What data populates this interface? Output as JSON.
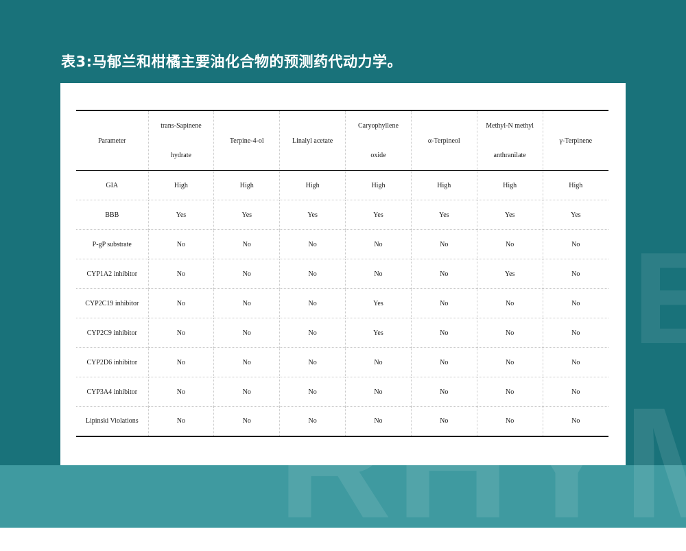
{
  "title": "表3:马郁兰和柑橘主要油化合物的预测药代动力学。",
  "watermark": {
    "right": "E",
    "bottom": "RHYME"
  },
  "table": {
    "headers": [
      {
        "line1": "Parameter",
        "line2": ""
      },
      {
        "line1": "trans-Sapinene",
        "line2": "hydrate"
      },
      {
        "line1": "Terpine-4-ol",
        "line2": ""
      },
      {
        "line1": "Linalyl acetate",
        "line2": ""
      },
      {
        "line1": "Caryophyllene",
        "line2": "oxide"
      },
      {
        "line1": "α-Terpineol",
        "line2": ""
      },
      {
        "line1": "Methyl-N methyl",
        "line2": "anthranilate"
      },
      {
        "line1": "γ-Terpinene",
        "line2": ""
      }
    ],
    "rows": [
      [
        "GIA",
        "High",
        "High",
        "High",
        "High",
        "High",
        "High",
        "High"
      ],
      [
        "BBB",
        "Yes",
        "Yes",
        "Yes",
        "Yes",
        "Yes",
        "Yes",
        "Yes"
      ],
      [
        "P-gP substrate",
        "No",
        "No",
        "No",
        "No",
        "No",
        "No",
        "No"
      ],
      [
        "CYP1A2 inhibitor",
        "No",
        "No",
        "No",
        "No",
        "No",
        "Yes",
        "No"
      ],
      [
        "CYP2C19 inhibitor",
        "No",
        "No",
        "No",
        "Yes",
        "No",
        "No",
        "No"
      ],
      [
        "CYP2C9 inhibitor",
        "No",
        "No",
        "No",
        "Yes",
        "No",
        "No",
        "No"
      ],
      [
        "CYP2D6 inhibitor",
        "No",
        "No",
        "No",
        "No",
        "No",
        "No",
        "No"
      ],
      [
        "CYP3A4 inhibitor",
        "No",
        "No",
        "No",
        "No",
        "No",
        "No",
        "No"
      ],
      [
        "Lipinski Violations",
        "No",
        "No",
        "No",
        "No",
        "No",
        "No",
        "No"
      ]
    ]
  }
}
